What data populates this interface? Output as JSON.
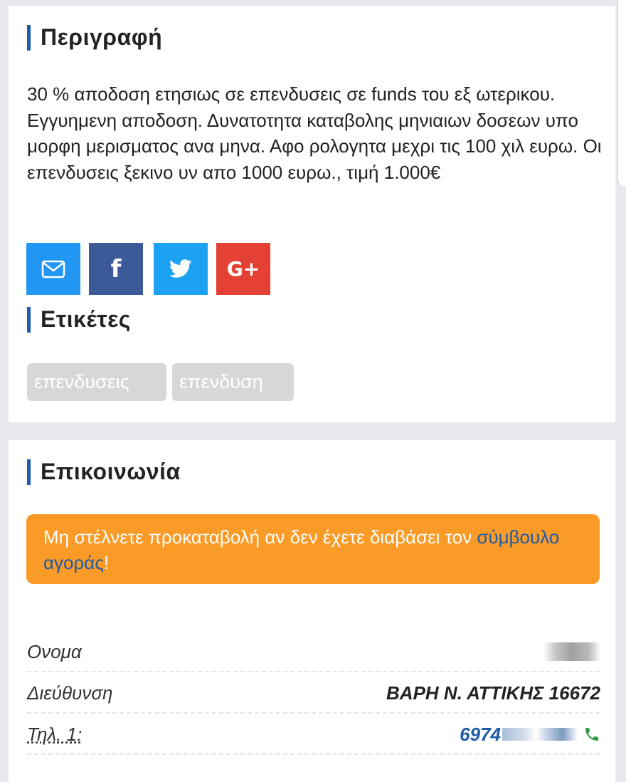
{
  "description_section": {
    "title": "Περιγραφή",
    "text": "30 % αποδοση ετησιως σε επενδυσεις σε funds του εξ ωτερικου. Εγγυημενη αποδοση. Δυνατοτητα καταβολης μηνιαιων δοσεων υπο μορφη μερισματος ανα μηνα. Αφο ρολογητα μεχρι τις 100 χιλ ευρω. Οι επενδυσεις ξεκινο υν απο 1000 ευρω., τιμή 1.000€",
    "share_buttons": [
      {
        "icon": "envelope-icon",
        "color": "#2196f3"
      },
      {
        "icon": "facebook-icon",
        "label": "f",
        "color": "#3b5a97"
      },
      {
        "icon": "twitter-icon",
        "color": "#1da1f2"
      },
      {
        "icon": "google-plus-icon",
        "label": "G+",
        "color": "#e44134"
      }
    ]
  },
  "tags_section": {
    "title": "Ετικέτες",
    "tags": [
      "επενδυσεις",
      "επενδυση"
    ]
  },
  "contact_section": {
    "title": "Επικοινωνία",
    "warning_text": "Μη στέλνετε προκαταβολή αν δεν έχετε διαβάσει τον ",
    "warning_link": "σύμβουλο αγοράς",
    "warning_suffix": "!",
    "rows": [
      {
        "label": "Ονομα",
        "value": ""
      },
      {
        "label": "Διεύθυνση",
        "value": "ΒΑΡΗ Ν. ΑΤΤΙΚΗΣ 16672"
      },
      {
        "label": "Τηλ. 1:",
        "value": "6974"
      }
    ]
  },
  "colors": {
    "accent_bar": "#1e5ba8",
    "warning_bg": "#fb9b27",
    "tag_bg": "#d7d7d7",
    "phone_icon": "#2e9b4e"
  }
}
